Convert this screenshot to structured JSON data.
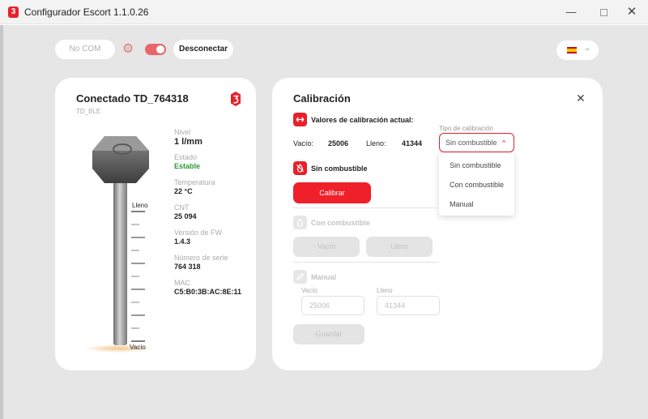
{
  "window": {
    "title": "Configurador Escort 1.1.0.26",
    "logo_glyph": "3",
    "minimize_glyph": "—",
    "close_glyph": "✕"
  },
  "toolbar": {
    "port": "No COM",
    "connection_switch_on": true,
    "disconnect_label": "Desconectar",
    "language_flag": "es-flag-icon",
    "language_chevron": "⌄"
  },
  "colors": {
    "accent": "#e8202a",
    "success": "#2a9a3a",
    "card_bg": "#ffffff",
    "app_bg": "#e6e6e6"
  },
  "device": {
    "title": "Conectado  TD_764318",
    "subtitle": "TD_BLE",
    "scale_full": "Lleno",
    "scale_empty": "Vacío",
    "props": [
      {
        "label": "Nivel",
        "value": "1 l/mm"
      },
      {
        "label": "Estado",
        "value": "Estable"
      },
      {
        "label": "Temperatura",
        "value": "22 °C"
      },
      {
        "label": "CNT",
        "value": "25 094"
      },
      {
        "label": "Versión de FW",
        "value": "1.4.3"
      },
      {
        "label": "Número de serie",
        "value": "764 318"
      },
      {
        "label": "MAC",
        "value": "C5:B0:3B:AC:8E:11"
      }
    ]
  },
  "calibration": {
    "title": "Calibración",
    "close_glyph": "✕",
    "current_label": "Valores de calibración actual:",
    "empty_label": "Vacío:",
    "empty_value": "25006",
    "full_label": "Lleno:",
    "full_value": "41344",
    "type_label": "Tipo de calibración",
    "type_selected": "Sin combustible",
    "type_chevron": "^",
    "type_options": [
      "Sin combustible",
      "Con combustible",
      "Manual"
    ],
    "no_fuel": {
      "label": "Sin combustible",
      "button": "Calibrar"
    },
    "with_fuel": {
      "label": "Con combustible",
      "empty_button": "Vacío",
      "full_button": "Lleno"
    },
    "manual": {
      "label": "Manual",
      "empty_label": "Vacío",
      "empty_value": "25006",
      "full_label": "Lleno",
      "full_value": "41344",
      "save_button": "Guardar"
    }
  }
}
